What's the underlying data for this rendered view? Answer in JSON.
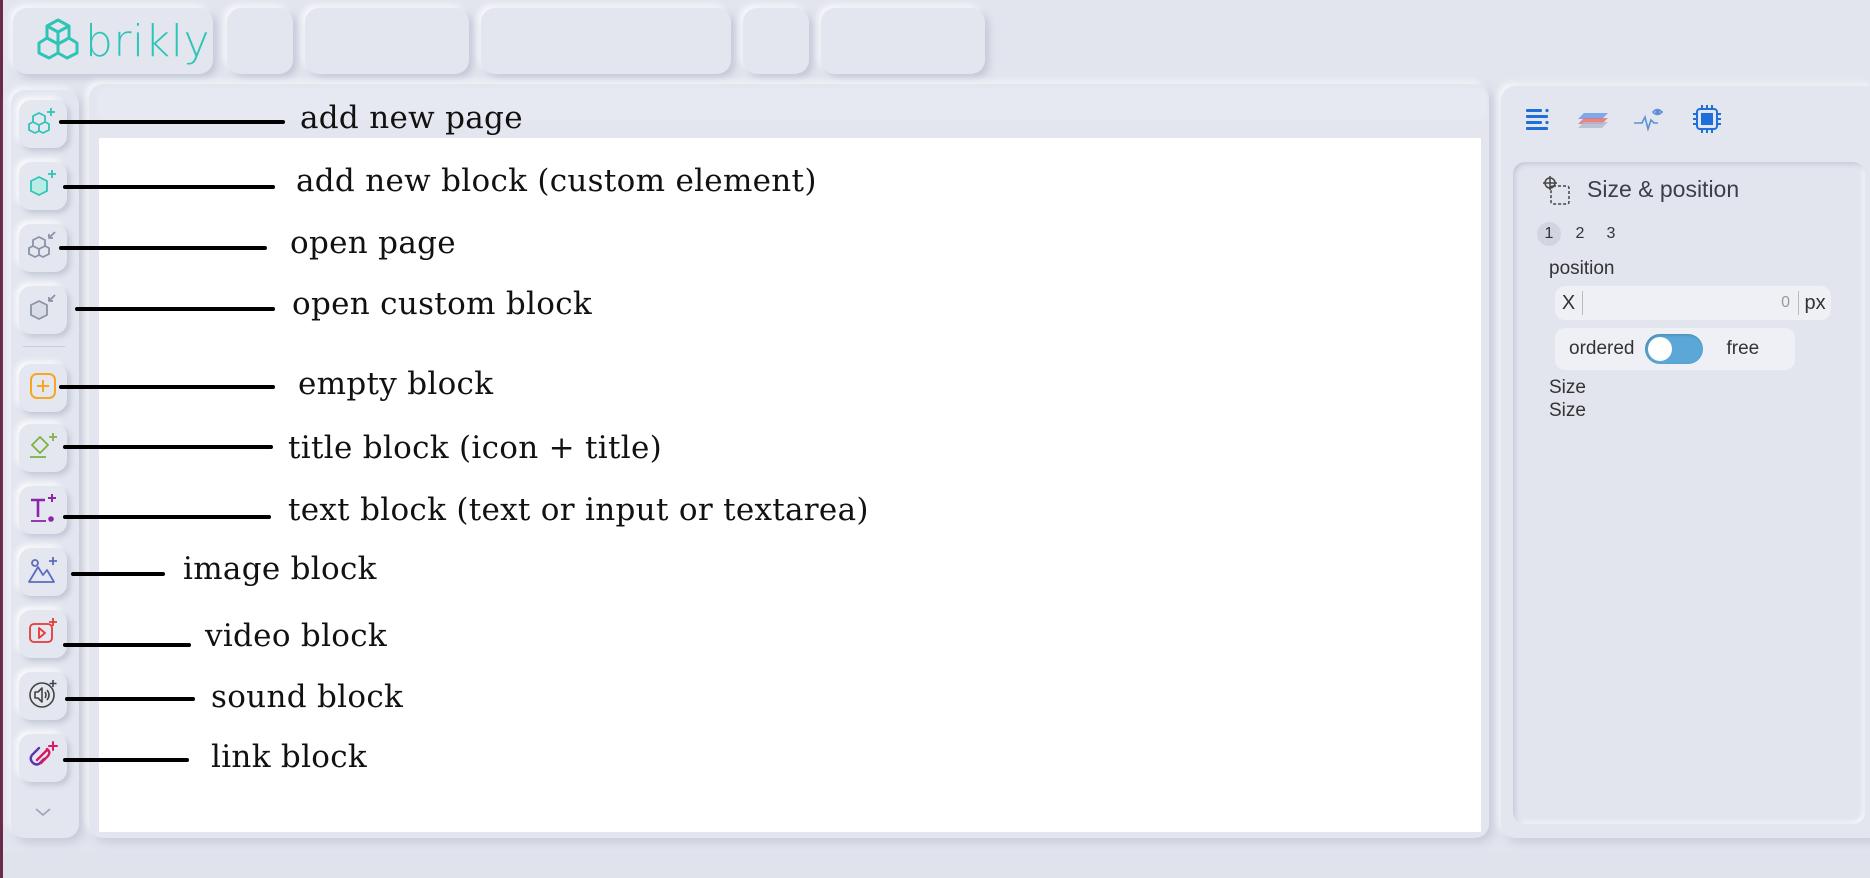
{
  "app": {
    "logo_text": "brikly",
    "brand_color": "#2ec4b6"
  },
  "toolbar": {
    "tools": [
      {
        "name": "add-page-button",
        "icon": "cubes-plus-icon"
      },
      {
        "name": "add-block-button",
        "icon": "cube-plus-icon"
      },
      {
        "name": "open-page-button",
        "icon": "cubes-open-icon"
      },
      {
        "name": "open-custom-block-button",
        "icon": "cube-open-icon"
      },
      {
        "name": "empty-block-button",
        "icon": "plus-square-icon"
      },
      {
        "name": "title-block-button",
        "icon": "diamond-title-icon"
      },
      {
        "name": "text-block-button",
        "icon": "text-plus-icon"
      },
      {
        "name": "image-block-button",
        "icon": "image-plus-icon"
      },
      {
        "name": "video-block-button",
        "icon": "video-plus-icon"
      },
      {
        "name": "sound-block-button",
        "icon": "sound-plus-icon"
      },
      {
        "name": "link-block-button",
        "icon": "link-plus-icon"
      }
    ],
    "more_icon": "chevron-down-icon"
  },
  "annotations": [
    "add new page",
    "add new block (custom element)",
    "open page",
    "open custom block",
    "empty block",
    "title block (icon + title)",
    "text block (text or input or textarea)",
    "image block",
    "video block",
    "sound block",
    "link block"
  ],
  "panel": {
    "tabs": [
      "list-icon",
      "layers-icon",
      "visibility-icon",
      "chip-icon"
    ],
    "section_title": "Size & position",
    "steps": [
      "1",
      "2",
      "3"
    ],
    "active_step": "1",
    "position_label": "position",
    "x_label": "X",
    "x_value": "0",
    "x_unit": "px",
    "mode_left": "ordered",
    "mode_right": "free",
    "size_label_1": "Size",
    "size_label_2": "Size"
  }
}
